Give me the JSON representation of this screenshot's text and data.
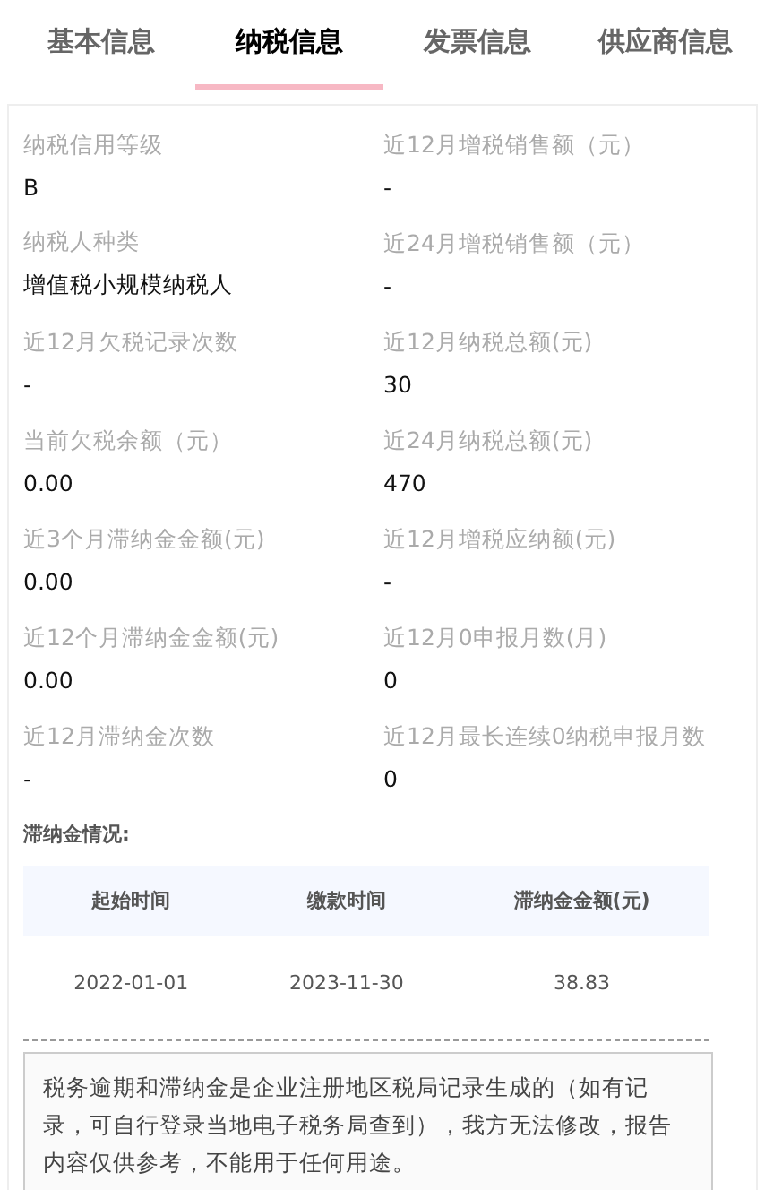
{
  "tabs": [
    {
      "label": "基本信息",
      "selected": false
    },
    {
      "label": "纳税信息",
      "selected": true
    },
    {
      "label": "发票信息",
      "selected": false
    },
    {
      "label": "供应商信息",
      "selected": false
    }
  ],
  "fields": [
    {
      "label": "纳税信用等级",
      "value": "B"
    },
    {
      "label": "近12月增税销售额（元）",
      "value": "-"
    },
    {
      "label": "纳税人种类",
      "value": "增值税小规模纳税人"
    },
    {
      "label": "近24月增税销售额（元）",
      "value": "-"
    },
    {
      "label": "近12月欠税记录次数",
      "value": "-"
    },
    {
      "label": "近12月纳税总额(元)",
      "value": "30"
    },
    {
      "label": "当前欠税余额（元）",
      "value": "0.00"
    },
    {
      "label": "近24月纳税总额(元)",
      "value": "470"
    },
    {
      "label": "近3个月滞纳金金额(元)",
      "value": "0.00"
    },
    {
      "label": "近12月增税应纳额(元)",
      "value": "-"
    },
    {
      "label": "近12个月滞纳金金额(元)",
      "value": "0.00"
    },
    {
      "label": "近12月0申报月数(月)",
      "value": "0"
    },
    {
      "label": "近12月滞纳金次数",
      "value": "-"
    },
    {
      "label": "近12月最长连续0纳税申报月数",
      "value": "0"
    }
  ],
  "late_fees": {
    "title": "滞纳金情况:",
    "columns": [
      "起始时间",
      "缴款时间",
      "滞纳金金额(元)"
    ],
    "rows": [
      [
        "2022-01-01",
        "2023-11-30",
        "38.83"
      ]
    ]
  },
  "note": "税务逾期和滞纳金是企业注册地区税局记录生成的（如有记录，可自行登录当地电子税务局查到），我方无法修改，报告内容仅供参考，不能用于任何用途。"
}
